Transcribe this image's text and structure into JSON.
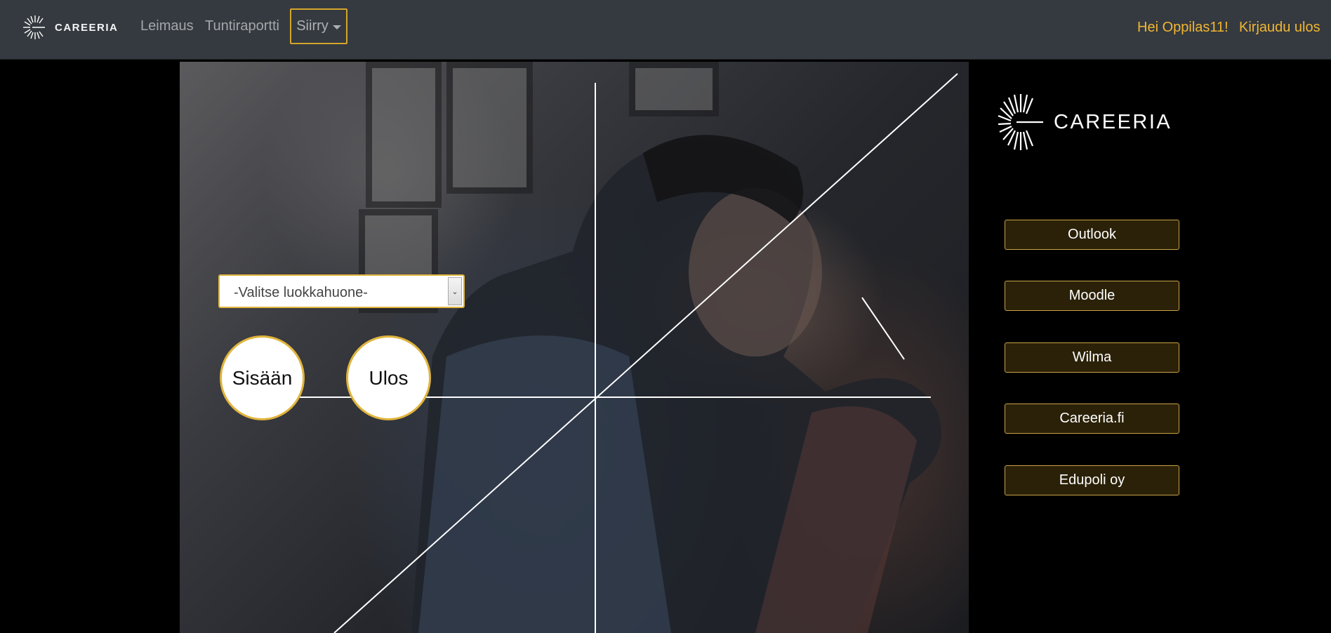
{
  "navbar": {
    "brand": "CAREERIA",
    "links": [
      "Leimaus",
      "Tuntiraportti"
    ],
    "dropdown_label": "Siirry",
    "greeting": "Hei Oppilas11!",
    "logout": "Kirjaudu ulos",
    "accent_color": "#f2b632"
  },
  "main": {
    "classroom_select": {
      "selected": "-Valitse luokkahuone-"
    },
    "check_in_label": "Sisään",
    "check_out_label": "Ulos"
  },
  "sidebar": {
    "logo_text": "CAREERIA",
    "links": [
      "Outlook",
      "Moodle",
      "Wilma",
      "Careeria.fi",
      "Edupoli oy"
    ]
  },
  "icons": [
    "careeria-logo-icon",
    "chevron-down-icon"
  ]
}
